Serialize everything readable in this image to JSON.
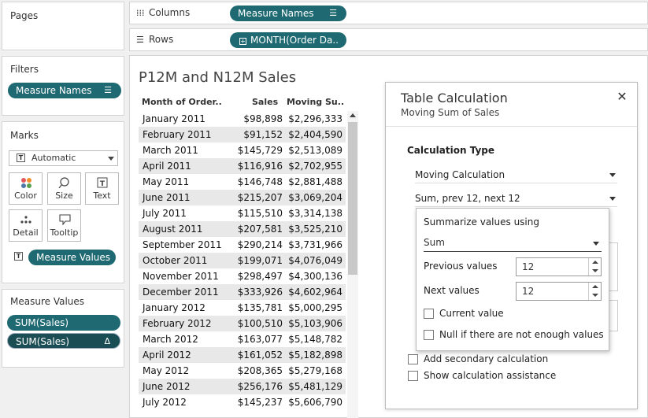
{
  "pages": {
    "title": "Pages"
  },
  "columns_shelf": {
    "label": "Columns",
    "pill": "Measure Names"
  },
  "rows_shelf": {
    "label": "Rows",
    "pill": "MONTH(Order Da.."
  },
  "filters": {
    "title": "Filters",
    "pill": "Measure Names"
  },
  "marks": {
    "title": "Marks",
    "type": "Automatic",
    "buttons": {
      "color": "Color",
      "size": "Size",
      "text": "Text",
      "detail": "Detail",
      "tooltip": "Tooltip"
    },
    "text_pill": "Measure Values"
  },
  "measure_values": {
    "title": "Measure Values",
    "pills": [
      "SUM(Sales)",
      "SUM(Sales)"
    ],
    "delta": "Δ"
  },
  "view": {
    "title": "P12M and N12M Sales",
    "headers": {
      "month": "Month of Order..",
      "sales": "Sales",
      "moving": "Moving Su.."
    },
    "rows": [
      [
        "January 2011",
        "$98,898",
        "$2,296,333"
      ],
      [
        "February 2011",
        "$91,152",
        "$2,404,590"
      ],
      [
        "March 2011",
        "$145,729",
        "$2,513,089"
      ],
      [
        "April 2011",
        "$116,916",
        "$2,702,955"
      ],
      [
        "May 2011",
        "$146,748",
        "$2,881,488"
      ],
      [
        "June 2011",
        "$215,207",
        "$3,069,204"
      ],
      [
        "July 2011",
        "$115,510",
        "$3,314,138"
      ],
      [
        "August 2011",
        "$207,581",
        "$3,525,210"
      ],
      [
        "September 2011",
        "$290,214",
        "$3,731,966"
      ],
      [
        "October 2011",
        "$199,071",
        "$4,076,049"
      ],
      [
        "November 2011",
        "$298,497",
        "$4,300,136"
      ],
      [
        "December 2011",
        "$333,926",
        "$4,602,964"
      ],
      [
        "January 2012",
        "$135,781",
        "$5,000,295"
      ],
      [
        "February 2012",
        "$100,510",
        "$5,103,906"
      ],
      [
        "March 2012",
        "$163,077",
        "$5,148,782"
      ],
      [
        "April 2012",
        "$161,052",
        "$5,182,898"
      ],
      [
        "May 2012",
        "$208,365",
        "$5,279,168"
      ],
      [
        "June 2012",
        "$256,176",
        "$5,481,129"
      ],
      [
        "July 2012",
        "$145,237",
        "$5,606,790"
      ]
    ]
  },
  "dialog": {
    "title": "Table Calculation",
    "subtitle": "Moving Sum of Sales",
    "close": "✕",
    "calc_type_label": "Calculation Type",
    "calc_type_value": "Moving Calculation",
    "summary_value": "Sum, prev 12, next 12",
    "add_secondary": "Add secondary calculation",
    "show_assistance": "Show calculation assistance"
  },
  "popup": {
    "summarize_label": "Summarize values using",
    "summarize_value": "Sum",
    "previous_label": "Previous values",
    "previous_value": "12",
    "next_label": "Next values",
    "next_value": "12",
    "current_value": "Current value",
    "null_if": "Null if there are not enough values"
  },
  "colors": {
    "pill": "#1f6a72",
    "pill_dark": "#1b4d54",
    "alt_row": "#e8e8e8"
  }
}
